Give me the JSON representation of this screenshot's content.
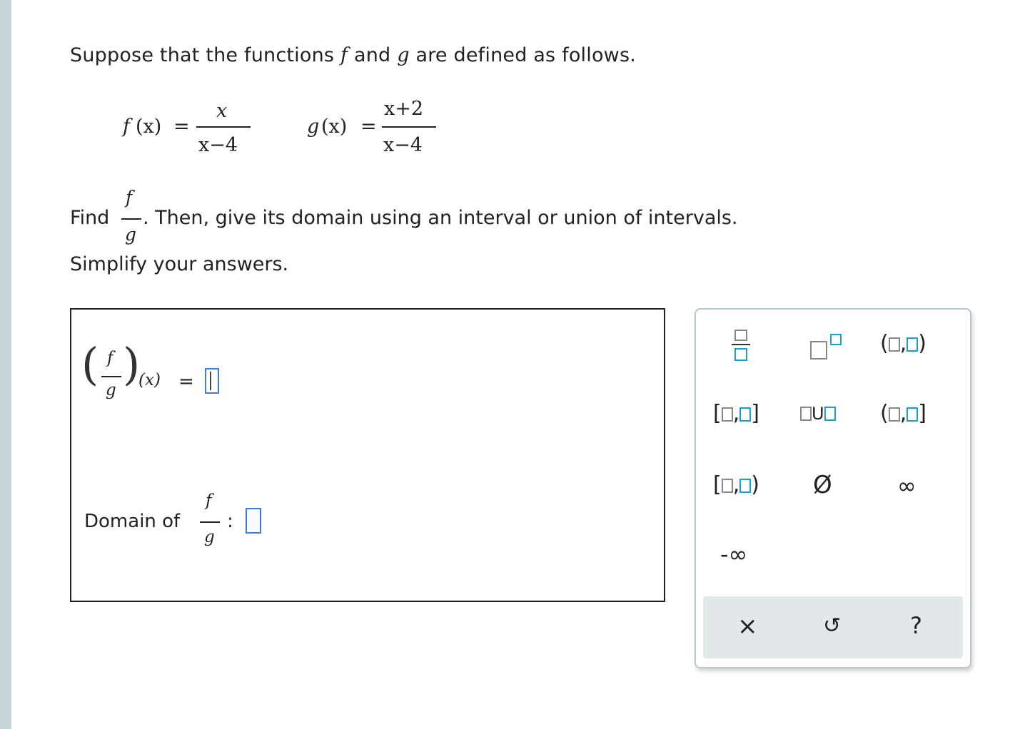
{
  "problem": {
    "intro_pre": "Suppose that the functions",
    "f": "f",
    "and": "and",
    "g": "g",
    "intro_post": "are defined as follows.",
    "f_def": {
      "lhs": "f",
      "arg": "(x)",
      "eq": "=",
      "num": "x",
      "den": "x−4"
    },
    "g_def": {
      "lhs": "g",
      "arg": "(x)",
      "eq": "=",
      "num": "x+2",
      "den": "x−4"
    },
    "find_label": "Find",
    "find_num": "f",
    "find_den": "g",
    "find_rest": ". Then, give its domain using an interval or union of intervals.",
    "simplify": "Simplify your answers."
  },
  "answer": {
    "quotient_num": "f",
    "quotient_den": "g",
    "quotient_arg": "(x)",
    "equals": "=",
    "domain_label": "Domain of",
    "domain_num": "f",
    "domain_den": "g",
    "colon": ":"
  },
  "palette": {
    "comma": ",",
    "union": "U",
    "empty_set": "Ø",
    "infinity": "∞",
    "neg_infinity": "-∞",
    "clear": "×",
    "undo": "↺",
    "help": "?"
  },
  "colors": {
    "accent": "#1f9fd1",
    "input_border": "#3a7bd5",
    "panel_border": "#b7c6cf",
    "bottom_bar": "#e2e7ea",
    "left_bar": "#c8d3d9"
  }
}
